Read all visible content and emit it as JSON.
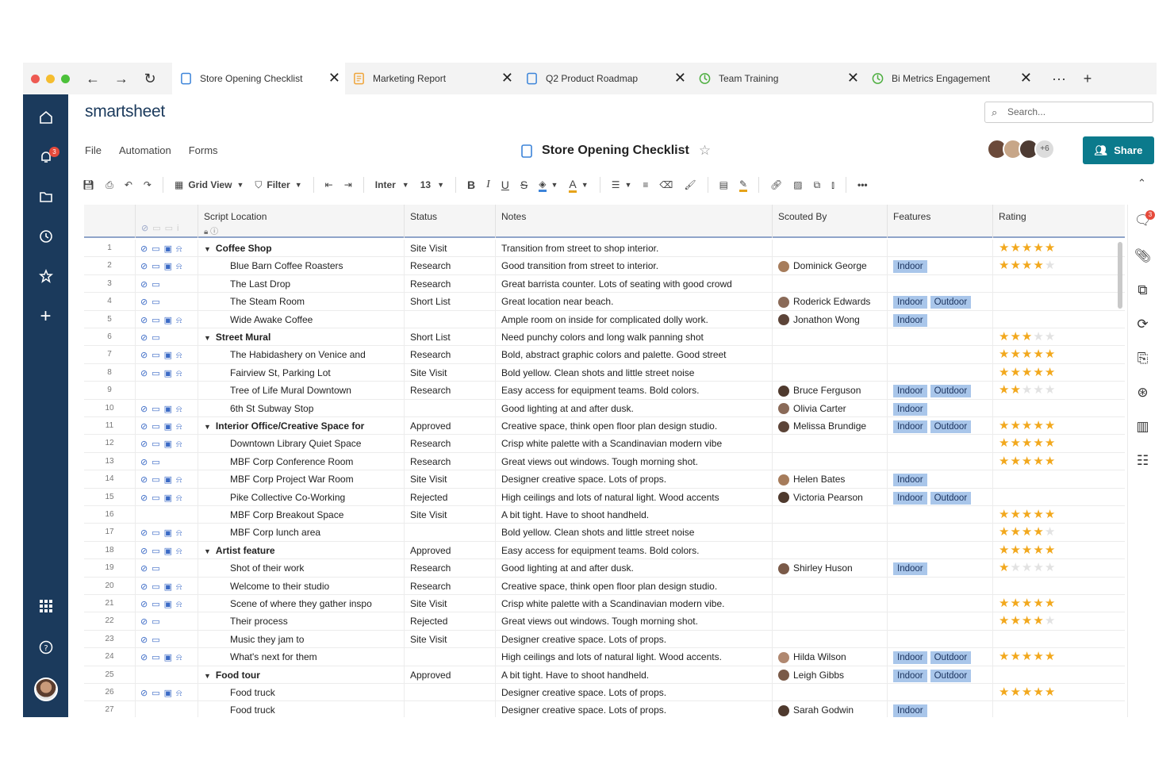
{
  "tabs": [
    {
      "label": "Store Opening Checklist",
      "icon": "sheet-icon",
      "active": true
    },
    {
      "label": "Marketing Report",
      "icon": "report-icon",
      "active": false
    },
    {
      "label": "Q2 Product Roadmap",
      "icon": "sheet-icon",
      "active": false
    },
    {
      "label": "Team Training",
      "icon": "dashboard-icon",
      "active": false
    },
    {
      "label": "Bi Metrics Engagement",
      "icon": "dashboard-icon",
      "active": false
    }
  ],
  "sidebar": {
    "notification_count": "3"
  },
  "brand": "smartsheet",
  "search": {
    "placeholder": "Search..."
  },
  "menu": {
    "file": "File",
    "automation": "Automation",
    "forms": "Forms"
  },
  "sheet_title": "Store Opening Checklist",
  "collaborators_extra": "+6",
  "share_label": "Share",
  "toolbar": {
    "view": "Grid View",
    "filter": "Filter",
    "font": "Inter",
    "size": "13"
  },
  "columns": {
    "script_location": "Script Location",
    "status": "Status",
    "notes": "Notes",
    "scouted_by": "Scouted By",
    "features": "Features",
    "rating": "Rating"
  },
  "rail": {
    "conversation_count": "3"
  },
  "colors": {
    "sidebar": "#1b3a5c",
    "share": "#0b7a8c",
    "badge": "#a9c6ea",
    "star": "#f2a81d"
  },
  "rows": [
    {
      "n": "1",
      "location": "Coffee Shop",
      "parent": true,
      "status": "Site Visit",
      "notes": "Transition from street to shop interior.",
      "scout": "",
      "features": [],
      "rating": 5,
      "icons": 4
    },
    {
      "n": "2",
      "location": "Blue Barn Coffee Roasters",
      "parent": false,
      "status": "Research",
      "notes": "Good transition from street to interior.",
      "scout": "Dominick George",
      "features": [
        "Indoor"
      ],
      "rating": 4,
      "icons": 4
    },
    {
      "n": "3",
      "location": "The Last Drop",
      "parent": false,
      "status": "Research",
      "notes": "Great barrista counter. Lots of seating with good crowd",
      "scout": "",
      "features": [],
      "rating": 0,
      "icons": 2
    },
    {
      "n": "4",
      "location": "The Steam Room",
      "parent": false,
      "status": "Short List",
      "notes": "Great location near beach.",
      "scout": "Roderick Edwards",
      "features": [
        "Indoor",
        "Outdoor"
      ],
      "rating": 0,
      "icons": 2
    },
    {
      "n": "5",
      "location": "Wide Awake Coffee",
      "parent": false,
      "status": "",
      "notes": "Ample room on inside for complicated dolly work.",
      "scout": "Jonathon Wong",
      "features": [
        "Indoor"
      ],
      "rating": 0,
      "icons": 4
    },
    {
      "n": "6",
      "location": "Street Mural",
      "parent": true,
      "status": "Short List",
      "notes": "Need punchy colors and long walk panning shot",
      "scout": "",
      "features": [],
      "rating": 3,
      "icons": 2
    },
    {
      "n": "7",
      "location": "The Habidashery on Venice and",
      "parent": false,
      "status": "Research",
      "notes": "Bold, abstract graphic colors and palette. Good street",
      "scout": "",
      "features": [],
      "rating": 5,
      "icons": 4
    },
    {
      "n": "8",
      "location": "Fairview St, Parking Lot",
      "parent": false,
      "status": "Site Visit",
      "notes": "Bold yellow. Clean shots and little street noise",
      "scout": "",
      "features": [],
      "rating": 5,
      "icons": 4
    },
    {
      "n": "9",
      "location": "Tree of Life Mural Downtown",
      "parent": false,
      "status": "Research",
      "notes": "Easy access for equipment teams. Bold colors.",
      "scout": "Bruce Ferguson",
      "features": [
        "Indoor",
        "Outdoor"
      ],
      "rating": 2,
      "icons": 0
    },
    {
      "n": "10",
      "location": "6th St Subway Stop",
      "parent": false,
      "status": "",
      "notes": "Good lighting at and after dusk.",
      "scout": "Olivia Carter",
      "features": [
        "Indoor"
      ],
      "rating": 0,
      "icons": 4
    },
    {
      "n": "11",
      "location": "Interior Office/Creative Space for",
      "parent": true,
      "status": "Approved",
      "notes": "Creative space, think open floor plan design studio.",
      "scout": "Melissa Brundige",
      "features": [
        "Indoor",
        "Outdoor"
      ],
      "rating": 5,
      "icons": 4
    },
    {
      "n": "12",
      "location": "Downtown Library Quiet Space",
      "parent": false,
      "status": "Research",
      "notes": "Crisp white palette with a Scandinavian modern vibe",
      "scout": "",
      "features": [],
      "rating": 5,
      "icons": 4
    },
    {
      "n": "13",
      "location": "MBF Corp Conference Room",
      "parent": false,
      "status": "Research",
      "notes": "Great views out windows. Tough morning shot.",
      "scout": "",
      "features": [],
      "rating": 5,
      "icons": 2
    },
    {
      "n": "14",
      "location": "MBF Corp Project War Room",
      "parent": false,
      "status": "Site Visit",
      "notes": "Designer creative space. Lots of props.",
      "scout": "Helen Bates",
      "features": [
        "Indoor"
      ],
      "rating": 0,
      "icons": 4
    },
    {
      "n": "15",
      "location": "Pike Collective Co-Working",
      "parent": false,
      "status": "Rejected",
      "notes": "High ceilings and lots of natural light. Wood accents",
      "scout": "Victoria Pearson",
      "features": [
        "Indoor",
        "Outdoor"
      ],
      "rating": 0,
      "icons": 4
    },
    {
      "n": "16",
      "location": "MBF Corp Breakout Space",
      "parent": false,
      "status": "Site Visit",
      "notes": "A bit tight. Have to shoot handheld.",
      "scout": "",
      "features": [],
      "rating": 5,
      "icons": 0
    },
    {
      "n": "17",
      "location": "MBF Corp lunch area",
      "parent": false,
      "status": "",
      "notes": "Bold yellow. Clean shots and little street noise",
      "scout": "",
      "features": [],
      "rating": 4,
      "icons": 4
    },
    {
      "n": "18",
      "location": "Artist feature",
      "parent": true,
      "status": "Approved",
      "notes": "Easy access for equipment teams. Bold colors.",
      "scout": "",
      "features": [],
      "rating": 5,
      "icons": 4
    },
    {
      "n": "19",
      "location": "Shot of their work",
      "parent": false,
      "status": "Research",
      "notes": "Good lighting at and after dusk.",
      "scout": "Shirley Huson",
      "features": [
        "Indoor"
      ],
      "rating": 1,
      "icons": 2
    },
    {
      "n": "20",
      "location": "Welcome to their studio",
      "parent": false,
      "status": "Research",
      "notes": "Creative space, think open floor plan design studio.",
      "scout": "",
      "features": [],
      "rating": 0,
      "icons": 4
    },
    {
      "n": "21",
      "location": "Scene of where they gather inspo",
      "parent": false,
      "status": "Site Visit",
      "notes": "Crisp white palette with a Scandinavian modern vibe.",
      "scout": "",
      "features": [],
      "rating": 5,
      "icons": 4
    },
    {
      "n": "22",
      "location": "Their process",
      "parent": false,
      "status": "Rejected",
      "notes": "Great views out windows. Tough morning shot.",
      "scout": "",
      "features": [],
      "rating": 4,
      "icons": 2
    },
    {
      "n": "23",
      "location": "Music they jam to",
      "parent": false,
      "status": "Site Visit",
      "notes": "Designer creative space. Lots of props.",
      "scout": "",
      "features": [],
      "rating": 0,
      "icons": 2
    },
    {
      "n": "24",
      "location": "What's next for them",
      "parent": false,
      "status": "",
      "notes": "High ceilings and lots of natural light. Wood accents.",
      "scout": "Hilda Wilson",
      "features": [
        "Indoor",
        "Outdoor"
      ],
      "rating": 5,
      "icons": 4
    },
    {
      "n": "25",
      "location": "Food tour",
      "parent": true,
      "status": "Approved",
      "notes": "A bit tight. Have to shoot handheld.",
      "scout": "Leigh Gibbs",
      "features": [
        "Indoor",
        "Outdoor"
      ],
      "rating": 0,
      "icons": 0
    },
    {
      "n": "26",
      "location": "Food truck",
      "parent": false,
      "status": "",
      "notes": "Designer creative space. Lots of props.",
      "scout": "",
      "features": [],
      "rating": 5,
      "icons": 4
    },
    {
      "n": "27",
      "location": "Food truck",
      "parent": false,
      "status": "",
      "notes": "Designer creative space. Lots of props.",
      "scout": "Sarah Godwin",
      "features": [
        "Indoor"
      ],
      "rating": 0,
      "icons": 0
    }
  ]
}
